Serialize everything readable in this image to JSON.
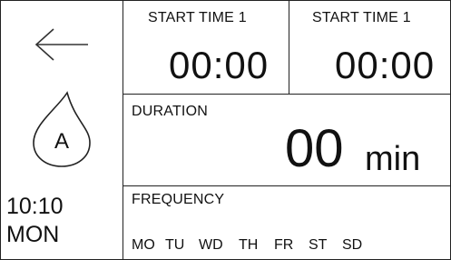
{
  "sidebar": {
    "back_icon": "left-arrow-icon",
    "zone_icon": "water-drop-icon",
    "zone_letter": "A",
    "time": "10:10",
    "day": "MON"
  },
  "start_time_1": {
    "label": "START TIME 1",
    "value": "00:00"
  },
  "start_time_2": {
    "label": "START TIME 1",
    "value": "00:00"
  },
  "duration": {
    "label": "DURATION",
    "value": "00",
    "unit": "min"
  },
  "frequency": {
    "label": "FREQUENCY",
    "days": [
      "MO",
      "TU",
      "WD",
      "TH",
      "FR",
      "ST",
      "SD"
    ]
  }
}
